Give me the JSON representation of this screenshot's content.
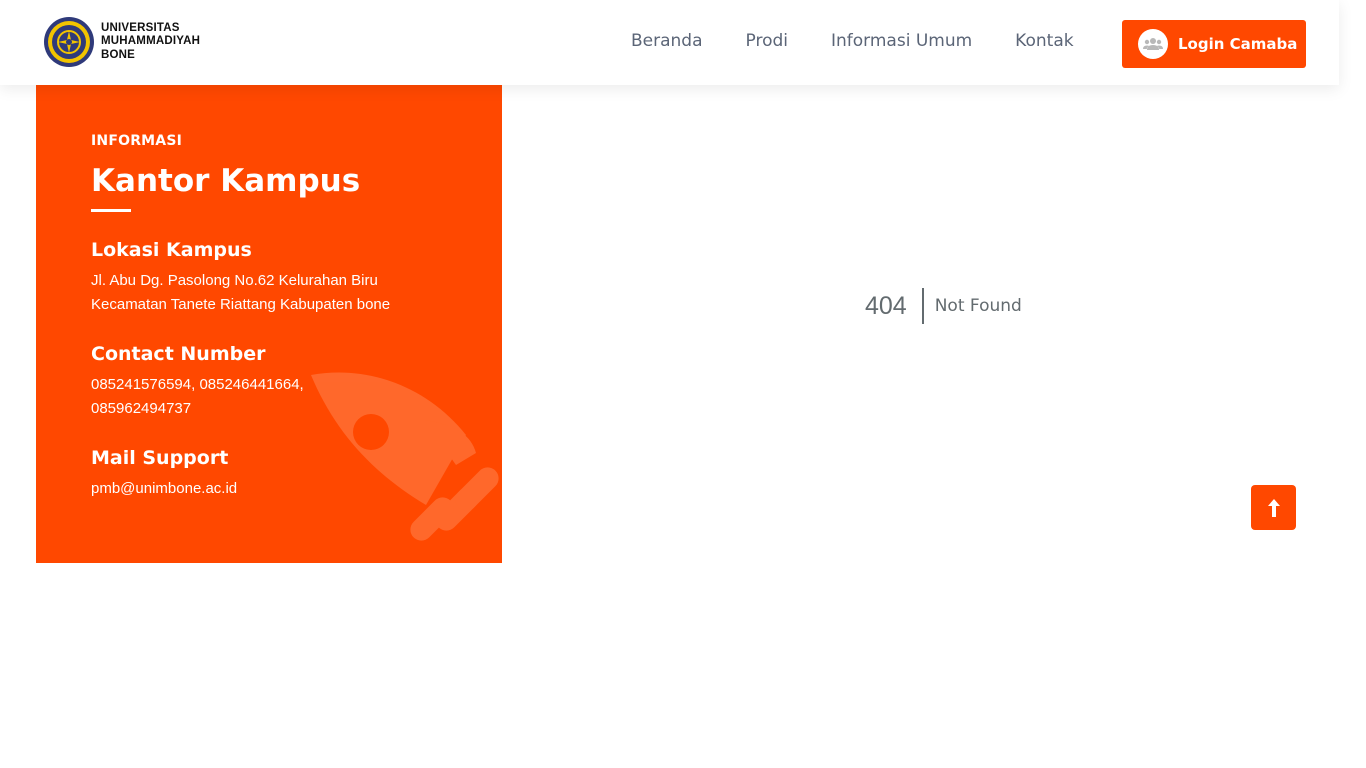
{
  "header": {
    "brand": {
      "logo_icon": "university-seal-logo",
      "line1": "UNIVERSITAS",
      "line2": "MUHAMMADIYAH",
      "line3": "BONE"
    },
    "nav": [
      {
        "label": "Beranda"
      },
      {
        "label": "Prodi"
      },
      {
        "label": "Informasi Umum"
      },
      {
        "label": "Kontak"
      }
    ],
    "login": {
      "label": "Login Camaba",
      "icon": "users-icon"
    }
  },
  "info": {
    "kicker": "INFORMASI",
    "title": "Kantor Kampus",
    "location": {
      "heading": "Lokasi Kampus",
      "line1": "Jl. Abu Dg. Pasolong No.62 Kelurahan Biru",
      "line2": "Kecamatan Tanete Riattang Kabupaten bone"
    },
    "contact": {
      "heading": "Contact Number",
      "line1": "085241576594, 085246441664,",
      "line2": "085962494737"
    },
    "mail": {
      "heading": "Mail Support",
      "value": "pmb@unimbone.ac.id"
    },
    "decor_icon": "rocket-icon"
  },
  "error": {
    "code": "404",
    "message": "Not Found"
  },
  "back_to_top": {
    "icon": "arrow-up-icon"
  },
  "colors": {
    "accent": "#ff4800",
    "nav_text": "#5b6577",
    "error_text": "#636b6f"
  }
}
